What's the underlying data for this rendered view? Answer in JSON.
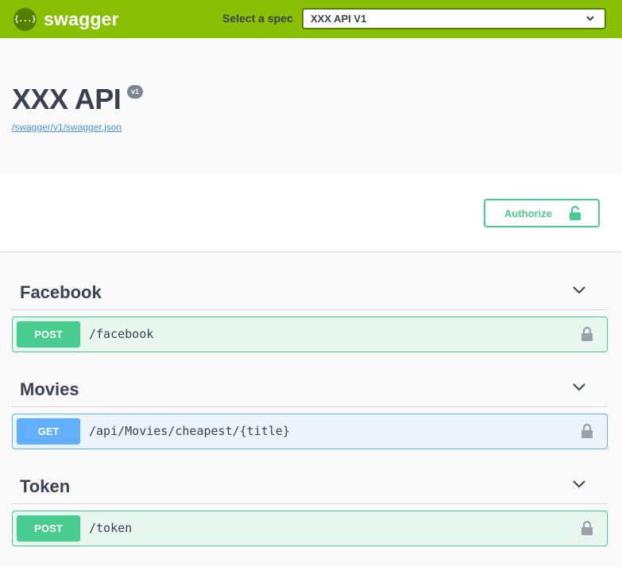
{
  "topbar": {
    "logo_glyph": "{...}",
    "brand": "swagger",
    "spec_label": "Select a spec",
    "spec_selected": "XXX API V1",
    "color": "#89bf04"
  },
  "info": {
    "title": "XXX API",
    "version": "v1",
    "spec_url": "/swagger/v1/swagger.json"
  },
  "scheme": {
    "authorize_label": "Authorize"
  },
  "tags": [
    {
      "name": "Facebook",
      "operations": [
        {
          "method": "POST",
          "path": "/facebook"
        }
      ]
    },
    {
      "name": "Movies",
      "operations": [
        {
          "method": "GET",
          "path": "/api/Movies/cheapest/{title}"
        }
      ]
    },
    {
      "name": "Token",
      "operations": [
        {
          "method": "POST",
          "path": "/token"
        }
      ]
    }
  ],
  "colors": {
    "post": "#49cc90",
    "get": "#61affe",
    "lock": "#9ca0a8"
  },
  "icons": [
    "swagger-logo-icon",
    "chevron-down-icon",
    "lock-icon"
  ]
}
